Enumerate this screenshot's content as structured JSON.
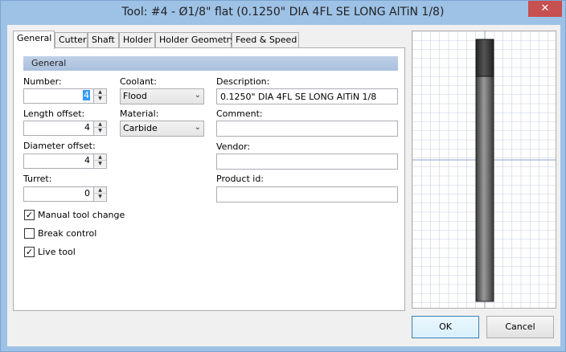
{
  "window": {
    "title": "Tool: #4 - Ø1/8\" flat (0.1250\" DIA 4FL SE LONG AlTiN 1/8)",
    "close_glyph": "✕"
  },
  "tabs": [
    {
      "label": "General"
    },
    {
      "label": "Cutter"
    },
    {
      "label": "Shaft"
    },
    {
      "label": "Holder"
    },
    {
      "label": "Holder Geometry"
    },
    {
      "label": "Feed & Speed"
    }
  ],
  "section": {
    "title": "General"
  },
  "fields": {
    "number": {
      "label": "Number:",
      "value": "4"
    },
    "length_offset": {
      "label": "Length offset:",
      "value": "4"
    },
    "diameter_offset": {
      "label": "Diameter offset:",
      "value": "4"
    },
    "turret": {
      "label": "Turret:",
      "value": "0"
    },
    "coolant": {
      "label": "Coolant:",
      "value": "Flood"
    },
    "material": {
      "label": "Material:",
      "value": "Carbide"
    },
    "description": {
      "label": "Description:",
      "value": "0.1250\" DIA 4FL SE LONG AlTiN 1/8"
    },
    "comment": {
      "label": "Comment:",
      "value": ""
    },
    "vendor": {
      "label": "Vendor:",
      "value": ""
    },
    "product_id": {
      "label": "Product id:",
      "value": ""
    }
  },
  "checkboxes": {
    "manual_tool_change": {
      "label": "Manual tool change",
      "checked": true
    },
    "break_control": {
      "label": "Break control",
      "checked": false
    },
    "live_tool": {
      "label": "Live tool",
      "checked": true
    }
  },
  "icons": {
    "spin_up": "▲",
    "spin_down": "▼",
    "combo_arrow": "⌄",
    "check": "✓"
  },
  "buttons": {
    "ok": "OK",
    "cancel": "Cancel"
  },
  "colors": {
    "grid_line": "#c8d0e0",
    "axis_line": "#8aa0c8",
    "tool_body": "#6a6a6a",
    "tool_tip": "#333333"
  }
}
